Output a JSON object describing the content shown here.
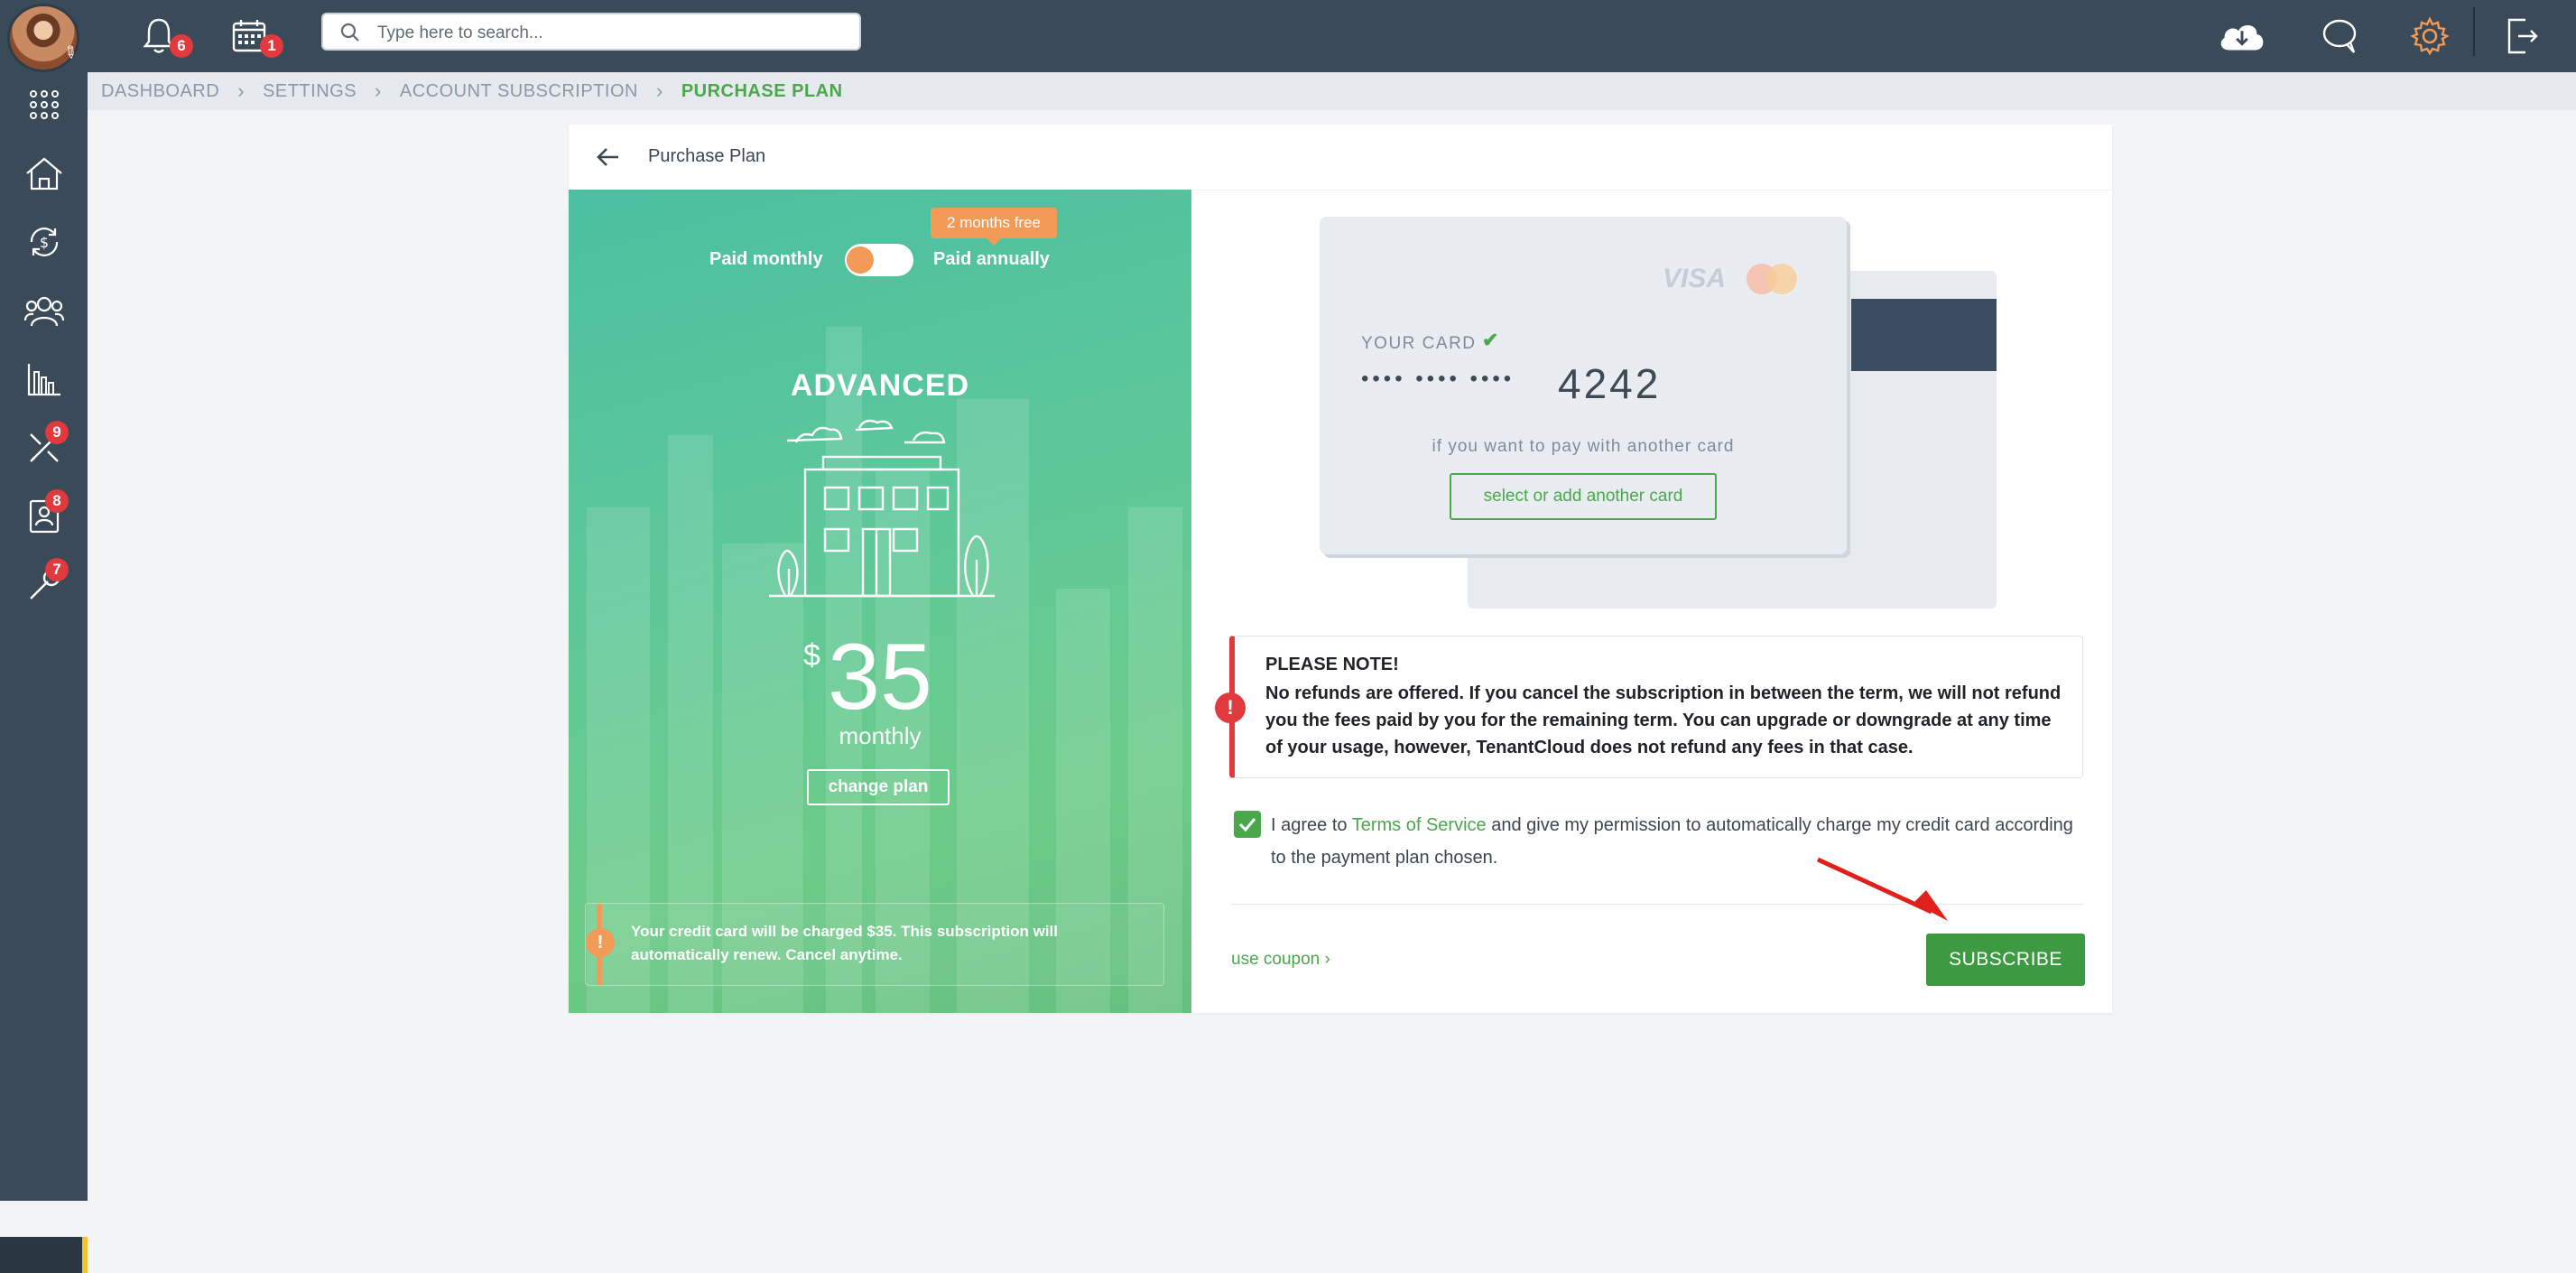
{
  "topbar": {
    "search_placeholder": "Type here to search...",
    "notifications_count": "6",
    "calendar_count": "1"
  },
  "sidebar": {
    "badges": [
      "9",
      "8",
      "7"
    ]
  },
  "breadcrumb": [
    "DASHBOARD",
    "SETTINGS",
    "ACCOUNT SUBSCRIPTION",
    "PURCHASE PLAN"
  ],
  "card": {
    "title": "Purchase Plan"
  },
  "plan": {
    "toggle_monthly": "Paid monthly",
    "toggle_annually": "Paid annually",
    "free_badge": "2 months free",
    "name": "ADVANCED",
    "currency": "$",
    "price": "35",
    "period": "monthly",
    "change_plan": "change plan",
    "charge_note": "Your credit card will be charged $35. This subscription will automatically renew. Cancel anytime."
  },
  "payment_card": {
    "brand_visa": "VISA",
    "label": "YOUR CARD",
    "masked": "•••• •••• ••••",
    "last4": "4242",
    "other_text": "if you want to pay with another card",
    "select_button": "select or add another card"
  },
  "note": {
    "title": "PLEASE NOTE!",
    "text": "No refunds are offered. If you cancel the subscription in between the term, we will not refund you the fees paid by you for the remaining term. You can upgrade or downgrade at any time of your usage, however, TenantCloud does not refund any fees in that case."
  },
  "agreement": {
    "prefix": "I agree to ",
    "link": "Terms of Service",
    "suffix": " and give my permission to automatically charge my credit card according to the payment plan chosen."
  },
  "footer": {
    "coupon": "use coupon ›",
    "subscribe": "SUBSCRIBE"
  },
  "colors": {
    "accent_green": "#4aa84b",
    "topbar": "#3a4a58",
    "orange": "#f29a57",
    "red": "#e0393e"
  }
}
